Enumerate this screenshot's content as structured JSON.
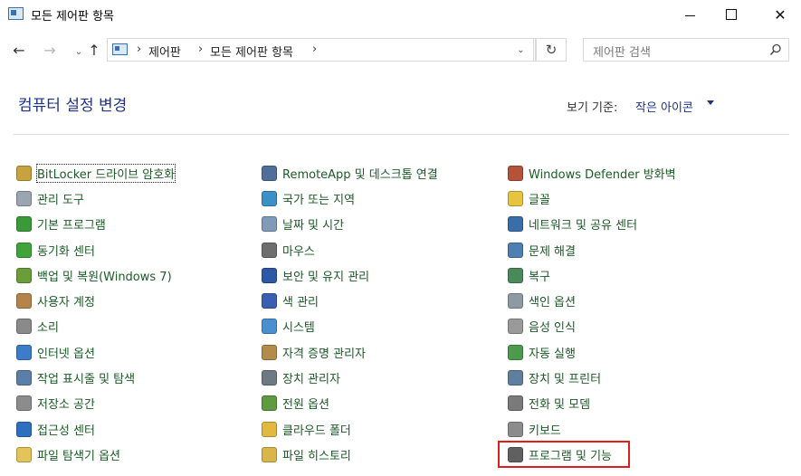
{
  "window": {
    "title": "모든 제어판 항목"
  },
  "nav": {
    "breadcrumb": [
      "제어판",
      "모든 제어판 항목"
    ],
    "search_placeholder": "제어판 검색"
  },
  "header": {
    "title": "컴퓨터 설정 변경",
    "view_label": "보기 기준:",
    "view_value": "작은 아이콘"
  },
  "items": {
    "col1": [
      {
        "label": "BitLocker 드라이브 암호화",
        "icon": "bitlocker-icon",
        "color": "#c9a240"
      },
      {
        "label": "관리 도구",
        "icon": "admin-tools-icon",
        "color": "#9aa5b1"
      },
      {
        "label": "기본 프로그램",
        "icon": "default-programs-icon",
        "color": "#3a9a3a"
      },
      {
        "label": "동기화 센터",
        "icon": "sync-center-icon",
        "color": "#41a33b"
      },
      {
        "label": "백업 및 복원(Windows 7)",
        "icon": "backup-icon",
        "color": "#6a9e3a"
      },
      {
        "label": "사용자 계정",
        "icon": "user-accounts-icon",
        "color": "#b5844d"
      },
      {
        "label": "소리",
        "icon": "sound-icon",
        "color": "#8a8a8a"
      },
      {
        "label": "인터넷 옵션",
        "icon": "internet-options-icon",
        "color": "#3d7cc9"
      },
      {
        "label": "작업 표시줄 및 탐색",
        "icon": "taskbar-icon",
        "color": "#5b7fa8"
      },
      {
        "label": "저장소 공간",
        "icon": "storage-spaces-icon",
        "color": "#8c8c8c"
      },
      {
        "label": "접근성 센터",
        "icon": "ease-of-access-icon",
        "color": "#2f6fbf"
      },
      {
        "label": "파일 탐색기 옵션",
        "icon": "file-explorer-options-icon",
        "color": "#e2c45a"
      }
    ],
    "col2": [
      {
        "label": "RemoteApp 및 데스크톱 연결",
        "icon": "remoteapp-icon",
        "color": "#4f6f9a"
      },
      {
        "label": "국가 또는 지역",
        "icon": "region-icon",
        "color": "#3c8fc7"
      },
      {
        "label": "날짜 및 시간",
        "icon": "date-time-icon",
        "color": "#7f9bb7"
      },
      {
        "label": "마우스",
        "icon": "mouse-icon",
        "color": "#6e6e6e"
      },
      {
        "label": "보안 및 유지 관리",
        "icon": "security-flag-icon",
        "color": "#2c58a6"
      },
      {
        "label": "색 관리",
        "icon": "color-management-icon",
        "color": "#3b5fb0"
      },
      {
        "label": "시스템",
        "icon": "system-icon",
        "color": "#4a8fd0"
      },
      {
        "label": "자격 증명 관리자",
        "icon": "credential-manager-icon",
        "color": "#b38b4a"
      },
      {
        "label": "장치 관리자",
        "icon": "device-manager-icon",
        "color": "#6d7a86"
      },
      {
        "label": "전원 옵션",
        "icon": "power-options-icon",
        "color": "#5e9a3f"
      },
      {
        "label": "클라우드 폴더",
        "icon": "work-folders-icon",
        "color": "#e0b93e"
      },
      {
        "label": "파일 히스토리",
        "icon": "file-history-icon",
        "color": "#d8b64a"
      }
    ],
    "col3": [
      {
        "label": "Windows Defender 방화벽",
        "icon": "firewall-icon",
        "color": "#b5533a"
      },
      {
        "label": "글꼴",
        "icon": "fonts-icon",
        "color": "#e6c43f"
      },
      {
        "label": "네트워크 및 공유 센터",
        "icon": "network-icon",
        "color": "#3a6ea8"
      },
      {
        "label": "문제 해결",
        "icon": "troubleshooting-icon",
        "color": "#4d7fb3"
      },
      {
        "label": "복구",
        "icon": "recovery-icon",
        "color": "#4a8a5a"
      },
      {
        "label": "색인 옵션",
        "icon": "indexing-options-icon",
        "color": "#8d9aa6"
      },
      {
        "label": "음성 인식",
        "icon": "speech-recognition-icon",
        "color": "#9a9a9a"
      },
      {
        "label": "자동 실행",
        "icon": "autoplay-icon",
        "color": "#4c9a4c"
      },
      {
        "label": "장치 및 프린터",
        "icon": "devices-printers-icon",
        "color": "#5f7f9f"
      },
      {
        "label": "전화 및 모뎀",
        "icon": "phone-modem-icon",
        "color": "#7a7a7a"
      },
      {
        "label": "키보드",
        "icon": "keyboard-icon",
        "color": "#8c8c8c"
      },
      {
        "label": "프로그램 및 기능",
        "icon": "programs-features-icon",
        "color": "#606060"
      }
    ]
  },
  "colors": {
    "heading": "#1e3287",
    "link": "#1a5a26",
    "highlight": "#e41c1c"
  }
}
